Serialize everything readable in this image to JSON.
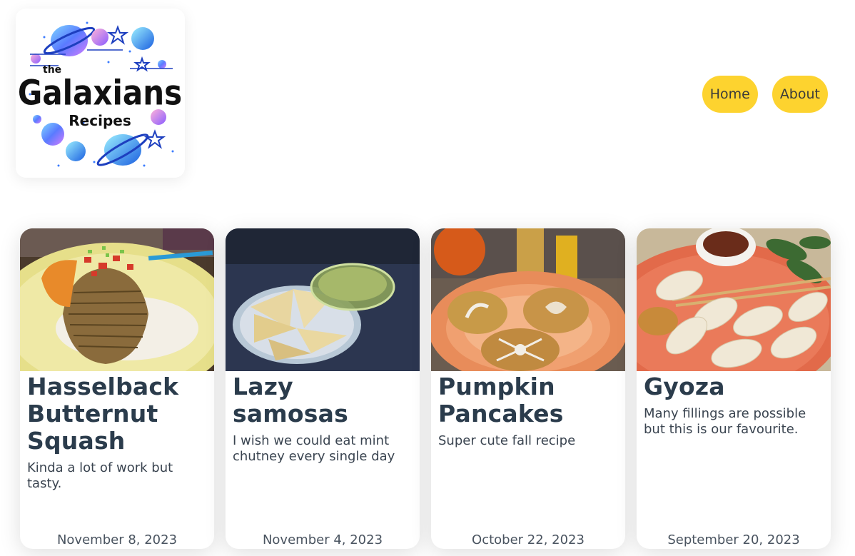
{
  "header": {
    "logo": {
      "line1": "the",
      "line2": "Galaxians",
      "line3": "Recipes"
    },
    "nav": [
      {
        "label": "Home"
      },
      {
        "label": "About"
      }
    ]
  },
  "cards": [
    {
      "title": "Hasselback Butternut Squash",
      "description": "Kinda a lot of work but tasty.",
      "date": "November 8, 2023",
      "image_icon": "hasselback-squash-photo"
    },
    {
      "title": "Lazy samosas",
      "description": "I wish we could eat mint chutney every single day",
      "date": "November 4, 2023",
      "image_icon": "samosas-photo"
    },
    {
      "title": "Pumpkin Pancakes",
      "description": "Super cute fall recipe",
      "date": "October 22, 2023",
      "image_icon": "pumpkin-pancakes-photo"
    },
    {
      "title": "Gyoza",
      "description": "Many fillings are possible but this is our favourite.",
      "date": "September 20, 2023",
      "image_icon": "gyoza-photo"
    }
  ],
  "colors": {
    "nav_button": "#fdd32f",
    "title_text": "#2b3c4c"
  }
}
